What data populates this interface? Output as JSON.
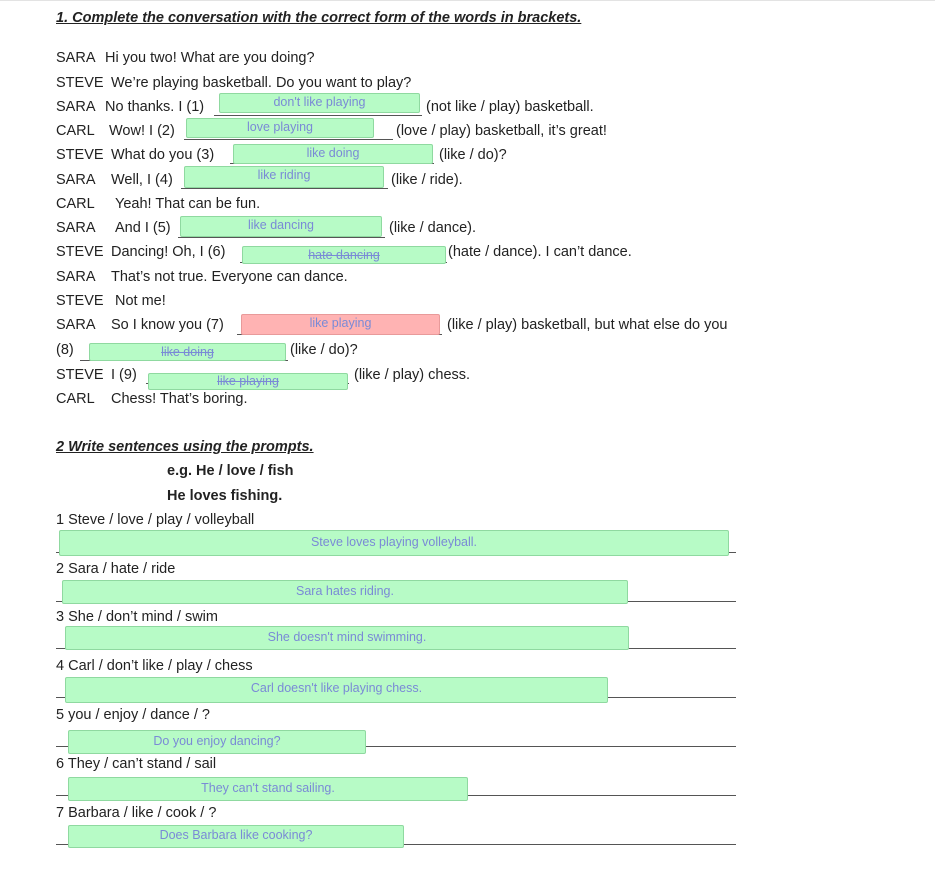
{
  "section1": {
    "heading": "1. Complete the conversation with the correct form of the words in brackets.",
    "lines": [
      {
        "speaker": "SARA",
        "text": "Hi you two! What are you doing?"
      },
      {
        "speaker": "STEVE",
        "text": "We’re playing basketball. Do you want to play?"
      },
      {
        "speaker": "SARA",
        "before": "No thanks. I (1)",
        "answer": "don't like playing",
        "after": "(not like / play) basketball."
      },
      {
        "speaker": "CARL",
        "before": "Wow! I (2)",
        "answer": "love playing",
        "after": "(love / play) basketball, it’s great!"
      },
      {
        "speaker": "STEVE",
        "before": "What do you (3)",
        "answer": "like doing",
        "after": "(like / do)?"
      },
      {
        "speaker": "SARA",
        "before": "Well, I (4)",
        "answer": "like riding",
        "after": "(like / ride)."
      },
      {
        "speaker": "CARL",
        "text": "Yeah! That can be fun."
      },
      {
        "speaker": "SARA",
        "before": "And I (5)",
        "answer": "like dancing",
        "after": "(like / dance)."
      },
      {
        "speaker": "STEVE",
        "before": "Dancing! Oh, I (6)",
        "answer": "hate dancing",
        "after": "(hate / dance). I can’t dance."
      },
      {
        "speaker": "SARA",
        "text": "That’s not true. Everyone can dance."
      },
      {
        "speaker": "STEVE",
        "text": "Not me!"
      },
      {
        "speaker": "SARA",
        "before": "So I know you (7)",
        "answer": "like playing",
        "after": "(like / play) basketball, but what else do you"
      },
      {
        "before": "(8)",
        "answer": "like doing",
        "after": "(like / do)?"
      },
      {
        "speaker": "STEVE",
        "before": "I (9)",
        "answer": "like playing",
        "after": "(like / play) chess."
      },
      {
        "speaker": "CARL",
        "text": "Chess! That’s boring."
      }
    ]
  },
  "section2": {
    "heading": "2 Write sentences using the prompts.",
    "example_prompt": "e.g. He / love / fish",
    "example_answer": "He loves fishing.",
    "items": [
      {
        "prompt": "1 Steve / love / play / volleyball",
        "answer": "Steve loves playing volleyball."
      },
      {
        "prompt": "2 Sara / hate / ride",
        "answer": "Sara hates riding."
      },
      {
        "prompt": "3 She / don’t mind / swim",
        "answer": "She doesn't mind swimming."
      },
      {
        "prompt": "4 Carl / don’t like / play / chess",
        "answer": "Carl doesn't like playing chess."
      },
      {
        "prompt": "5 you / enjoy / dance / ?",
        "answer": "Do you enjoy dancing?"
      },
      {
        "prompt": "6 They / can’t stand / sail",
        "answer": "They can't stand sailing."
      },
      {
        "prompt": "7 Barbara / like / cook / ?",
        "answer": "Does Barbara like cooking?"
      }
    ]
  },
  "colors": {
    "correct": "#b7fbc6",
    "incorrect": "#ffb3b3",
    "answer_text": "#7a8ad6"
  }
}
